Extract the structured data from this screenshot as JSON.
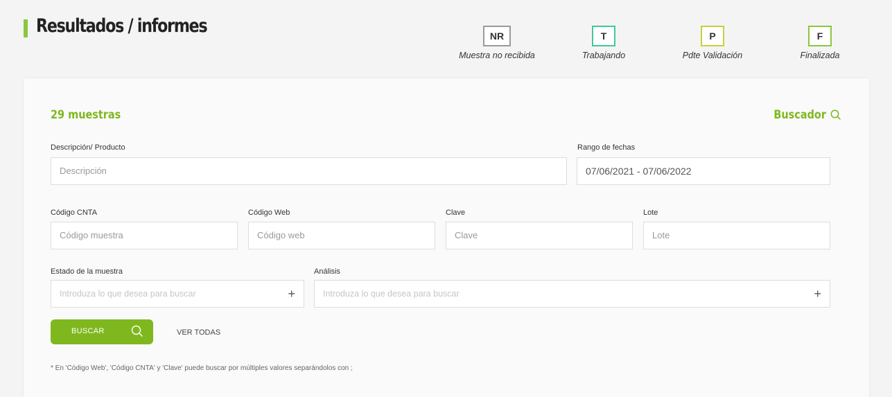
{
  "header": {
    "title": "Resultados / informes",
    "legend": [
      {
        "code": "NR",
        "label": "Muestra no recibida",
        "color": "#9a9a9a"
      },
      {
        "code": "T",
        "label": "Trabajando",
        "color": "#3ec99a"
      },
      {
        "code": "P",
        "label": "Pdte Validación",
        "color": "#c9d03a"
      },
      {
        "code": "F",
        "label": "Finalizada",
        "color": "#8cc63f"
      }
    ]
  },
  "card": {
    "count_title": "29 muestras",
    "finder_label": "Buscador",
    "accent": "#7fb81e"
  },
  "filters": {
    "descripcion": {
      "label": "Descripción/ Producto",
      "placeholder": "Descripción"
    },
    "rango": {
      "label": "Rango de fechas",
      "value": "07/06/2021 - 07/06/2022"
    },
    "codigo_cnta": {
      "label": "Código CNTA",
      "placeholder": "Código muestra"
    },
    "codigo_web": {
      "label": "Código Web",
      "placeholder": "Código web"
    },
    "clave": {
      "label": "Clave",
      "placeholder": "Clave"
    },
    "lote": {
      "label": "Lote",
      "placeholder": "Lote"
    },
    "estado": {
      "label": "Estado de la muestra",
      "placeholder": "Introduza lo que desea para buscar"
    },
    "analisis": {
      "label": "Análisis",
      "placeholder": "Introduza lo que desea para buscar"
    }
  },
  "actions": {
    "search_label": "BUSCAR",
    "view_all_label": "VER TODAS",
    "search_icon": "search-icon",
    "add_icon": "plus-icon"
  },
  "footnote": "* En 'Código Web', 'Código CNTA' y 'Clave' puede buscar por múltiples valores separándolos con ;"
}
